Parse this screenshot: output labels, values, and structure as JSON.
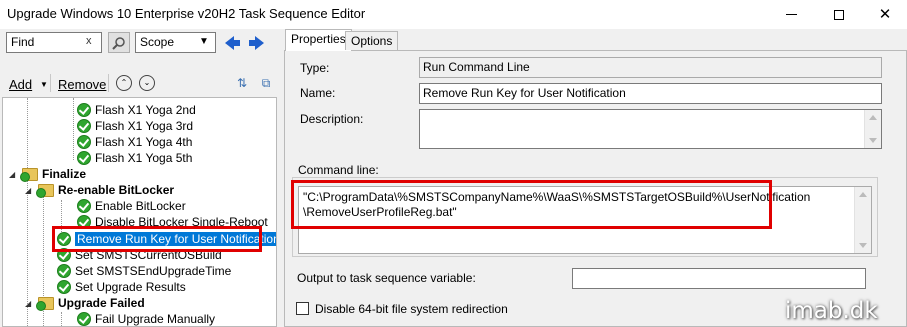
{
  "window": {
    "title": "Upgrade Windows 10 Enterprise v20H2 Task Sequence Editor",
    "controls": {
      "minimize": "minimize",
      "maximize": "maximize",
      "close": "✕"
    }
  },
  "left": {
    "search": {
      "value": "Find",
      "clear": "x"
    },
    "scope": {
      "value": "Scope"
    },
    "toolbar": {
      "add_label": "Add",
      "remove_label": "Remove"
    },
    "tree": [
      {
        "label": "Flash X1 Yoga 2nd",
        "icon": "check-icon",
        "bold": false,
        "selected": false
      },
      {
        "label": "Flash X1 Yoga 3rd",
        "icon": "check-icon",
        "bold": false,
        "selected": false
      },
      {
        "label": "Flash X1 Yoga 4th",
        "icon": "check-icon",
        "bold": false,
        "selected": false
      },
      {
        "label": "Flash X1 Yoga 5th",
        "icon": "check-icon",
        "bold": false,
        "selected": false
      },
      {
        "label": "Finalize",
        "icon": "folder-icon",
        "bold": true,
        "selected": false
      },
      {
        "label": "Re-enable BitLocker",
        "icon": "folder-icon",
        "bold": true,
        "selected": false
      },
      {
        "label": "Enable BitLocker",
        "icon": "check-icon",
        "bold": false,
        "selected": false
      },
      {
        "label": "Disable BitLocker Single-Reboot",
        "icon": "check-icon",
        "bold": false,
        "selected": false
      },
      {
        "label": "Remove Run Key for User Notification",
        "icon": "check-icon",
        "bold": false,
        "selected": true
      },
      {
        "label": "Set SMSTSCurrentOSBuild",
        "icon": "check-icon",
        "bold": false,
        "selected": false
      },
      {
        "label": "Set SMSTSEndUpgradeTime",
        "icon": "check-icon",
        "bold": false,
        "selected": false
      },
      {
        "label": "Set Upgrade Results",
        "icon": "check-icon",
        "bold": false,
        "selected": false
      },
      {
        "label": "Upgrade Failed",
        "icon": "folder-icon",
        "bold": true,
        "selected": false
      },
      {
        "label": "Fail Upgrade Manually",
        "icon": "check-icon",
        "bold": false,
        "selected": false
      }
    ]
  },
  "right": {
    "tabs": [
      {
        "label": "Properties",
        "active": true
      },
      {
        "label": "Options",
        "active": false
      }
    ],
    "type": {
      "label": "Type:",
      "value": "Run Command Line"
    },
    "name": {
      "label": "Name:",
      "value": "Remove Run Key for User Notification"
    },
    "description": {
      "label": "Description:",
      "value": ""
    },
    "command_line": {
      "label": "Command line:",
      "line1": "\"C:\\ProgramData\\%SMSTSCompanyName%\\WaaS\\%SMSTSTargetOSBuild%\\UserNotification",
      "line2": "\\RemoveUserProfileReg.bat\""
    },
    "output_variable": {
      "label": "Output to task sequence variable:",
      "value": ""
    },
    "disable_redirection": {
      "label": "Disable 64-bit file system redirection",
      "checked": false
    }
  },
  "watermark": "imab.dk",
  "colors": {
    "selection": "#0078d7",
    "highlight_box": "#e00000",
    "success_check": "#2fa52f",
    "folder": "#e8c55a"
  }
}
